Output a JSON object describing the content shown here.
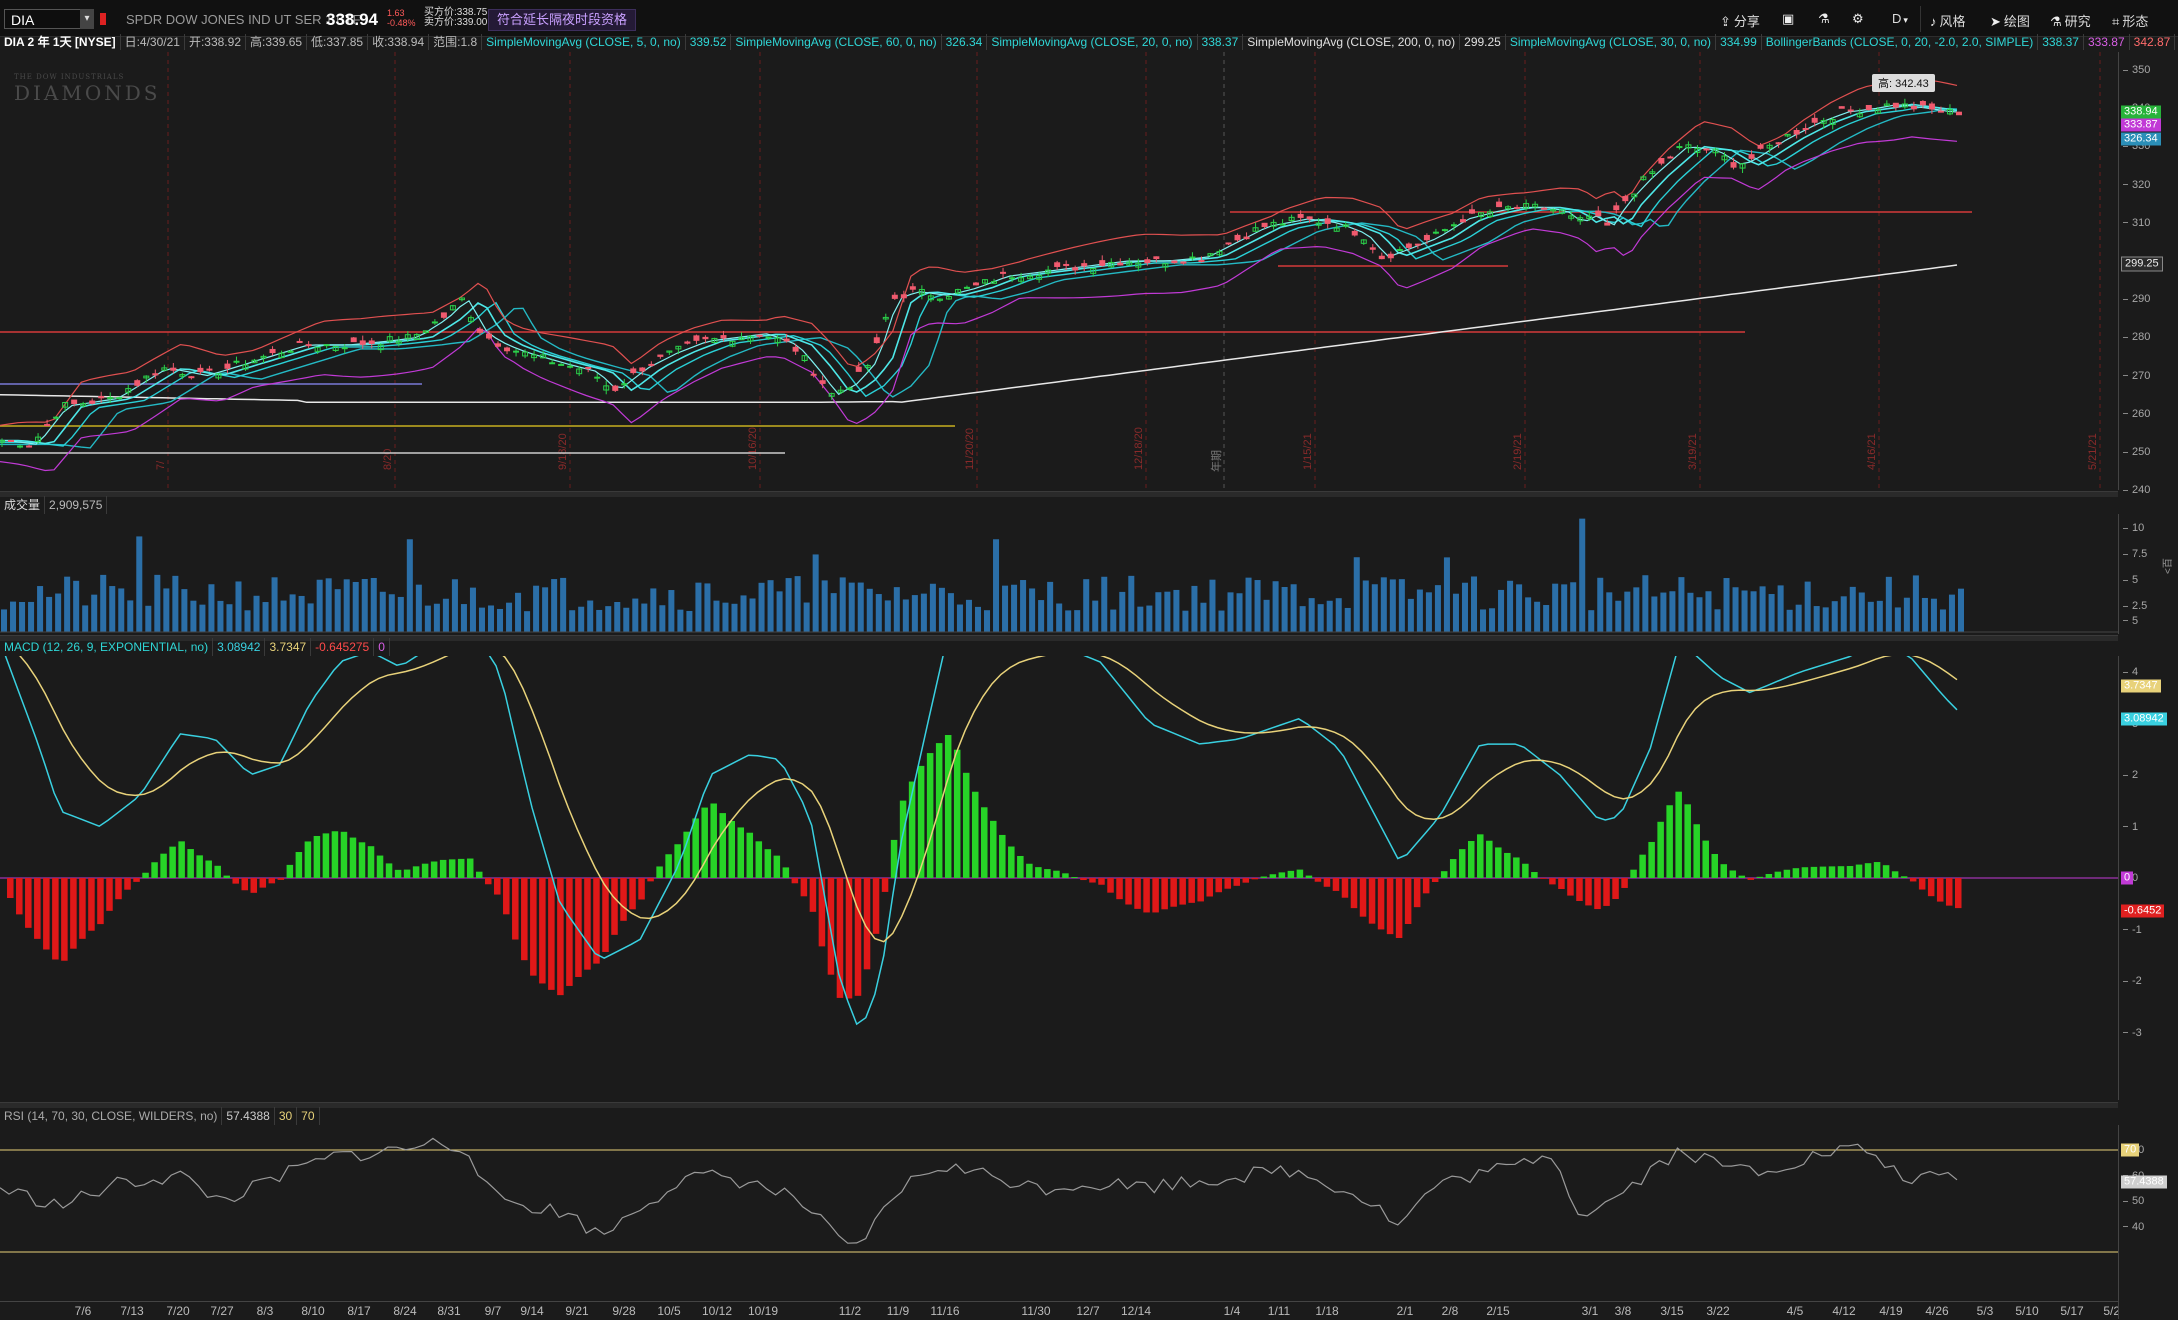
{
  "header": {
    "symbol": "DIA",
    "description": "SPDR DOW JONES IND UT SER 1 ETF",
    "last_price": "338.94",
    "change_abs": "1.63",
    "change_pct": "-0.48%",
    "bid": "买方价:338.75",
    "ask": "卖方价:339.00",
    "extended_hours_button": "符合延长隔夜时段资格",
    "tools": [
      {
        "label": "分享",
        "icon": "share-icon"
      },
      {
        "label": "",
        "icon": "grid-icon"
      },
      {
        "label": "",
        "icon": "flask-icon"
      },
      {
        "label": "",
        "icon": "gear-icon"
      },
      {
        "label": "D",
        "icon": "drawing-set-icon"
      },
      {
        "label": "风格",
        "icon": "style-icon"
      },
      {
        "label": "绘图",
        "icon": "cursor-icon"
      },
      {
        "label": "研究",
        "icon": "study-icon"
      },
      {
        "label": "形态",
        "icon": "pattern-icon"
      }
    ]
  },
  "studies_bar": {
    "chart_label": "DIA 2 年 1天 [NYSE]",
    "date": "日:4/30/21",
    "open": "开:338.92",
    "high": "高:339.65",
    "low": "低:337.85",
    "close": "收:338.94",
    "range": "范围:1.8",
    "sma5": "SimpleMovingAvg (CLOSE, 5, 0, no)",
    "sma5_val": "339.52",
    "sma60": "SimpleMovingAvg (CLOSE, 60, 0, no)",
    "sma60_val": "326.34",
    "sma20": "SimpleMovingAvg (CLOSE, 20, 0, no)",
    "sma20_val": "338.37",
    "sma200": "SimpleMovingAvg (CLOSE, 200, 0, no)",
    "sma200_val": "299.25",
    "sma30": "SimpleMovingAvg (CLOSE, 30, 0, no)",
    "sma30_val": "334.99",
    "bb": "BollingerBands (CLOSE, 0, 20, -2.0, 2.0, SIMPLE)",
    "bb_mid": "338.37",
    "bb_low": "333.87",
    "bb_up": "342.87"
  },
  "watermark": {
    "small": "THE DOW INDUSTRIALS",
    "big": "DIAMONDS"
  },
  "high_marker": "高: 342.43",
  "volume_header": {
    "label": "成交量",
    "value": "2,909,575"
  },
  "macd_header": {
    "label": "MACD (12, 26, 9, EXPONENTIAL, no)",
    "value": "3.08942",
    "avg": "3.7347",
    "diff": "-0.645275",
    "zero": "0"
  },
  "rsi_header": {
    "label": "RSI (14, 70, 30, CLOSE, WILDERS, no)",
    "value": "57.4388",
    "low": "30",
    "high": "70"
  },
  "price_axis": {
    "ticks": [
      "350",
      "340",
      "330",
      "320",
      "310",
      "300",
      "290",
      "280",
      "270",
      "260",
      "250",
      "240"
    ],
    "tags": [
      {
        "text": "338.94",
        "color": "#27b33a"
      },
      {
        "text": "333.87",
        "color": "#c13ad6"
      },
      {
        "text": "326.34",
        "color": "#2b8fb8"
      },
      {
        "text": "299.25",
        "color": "#2a2a2a"
      }
    ]
  },
  "volume_axis": {
    "ticks": [
      "10",
      "7.5",
      "5",
      "2.5"
    ],
    "unit": "<百万>"
  },
  "macd_axis": {
    "ticks": [
      "5",
      "4",
      "3",
      "2",
      "1",
      "0",
      "-1",
      "-2",
      "-3"
    ],
    "tags": [
      {
        "text": "3.7347",
        "color": "#e8d27a"
      },
      {
        "text": "3.08942",
        "color": "#39d0e0"
      },
      {
        "text": "0",
        "color": "#c13ad6"
      },
      {
        "text": "-0.6452",
        "color": "#e02020"
      }
    ]
  },
  "rsi_axis": {
    "ticks": [
      "70",
      "60",
      "50",
      "40"
    ],
    "tags": [
      {
        "text": "70",
        "color": "#e8d27a"
      },
      {
        "text": "57.4388",
        "color": "#cfcfcf"
      }
    ]
  },
  "dates": [
    "7/6",
    "7/13",
    "7/20",
    "7/27",
    "8/3",
    "8/10",
    "8/17",
    "8/24",
    "8/31",
    "9/7",
    "9/14",
    "9/21",
    "9/28",
    "10/5",
    "10/12",
    "10/19",
    "11/2",
    "11/9",
    "11/16",
    "11/30",
    "12/7",
    "12/14",
    "1/4",
    "1/11",
    "1/18",
    "2/1",
    "2/8",
    "2/15",
    "3/1",
    "3/8",
    "3/15",
    "3/22",
    "4/5",
    "4/12",
    "4/19",
    "4/26",
    "5/3",
    "5/10",
    "5/17",
    "5/24"
  ],
  "event_labels": [
    "7/",
    "8/20",
    "9/18/20",
    "10/16/20",
    "11/20/20",
    "12/18/20",
    "1/15/21",
    "2/19/21",
    "3/19/21",
    "4/16/21",
    "5/21/21"
  ],
  "year_label": "年期"
}
